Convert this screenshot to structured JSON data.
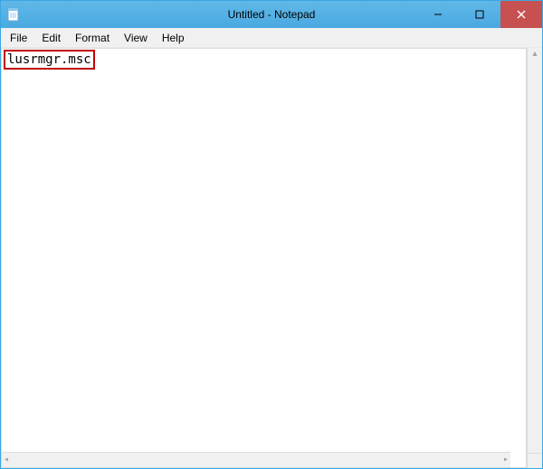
{
  "window": {
    "title": "Untitled - Notepad"
  },
  "controls": {
    "minimize": "–",
    "maximize": "□",
    "close": "✕"
  },
  "menu": {
    "file": "File",
    "edit": "Edit",
    "format": "Format",
    "view": "View",
    "help": "Help"
  },
  "editor": {
    "content": "lusrmgr.msc"
  },
  "scroll": {
    "up": "▴",
    "down": "▾",
    "left": "◂",
    "right": "▸"
  }
}
